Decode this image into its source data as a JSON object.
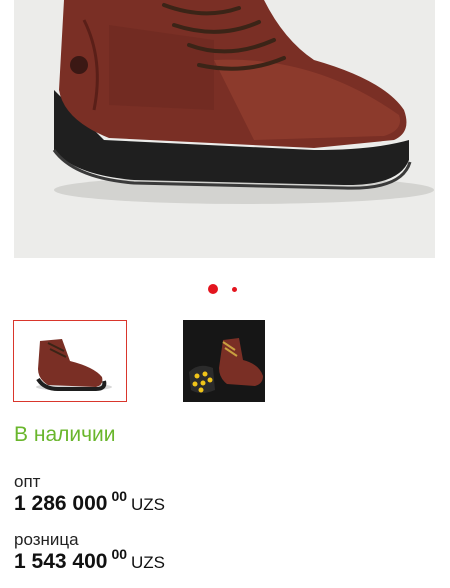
{
  "gallery": {
    "main_image_alt": "Work boot",
    "slide_count": 2,
    "active_slide": 1,
    "accent_color": "#e3141e"
  },
  "availability": {
    "text": "В наличии",
    "color": "#69b62c"
  },
  "prices": {
    "wholesale": {
      "label": "опт",
      "amount": "1 286 000",
      "cents": "00",
      "currency": "UZS"
    },
    "retail": {
      "label": "розница",
      "amount": "1 543 400",
      "cents": "00",
      "currency": "UZS"
    }
  }
}
